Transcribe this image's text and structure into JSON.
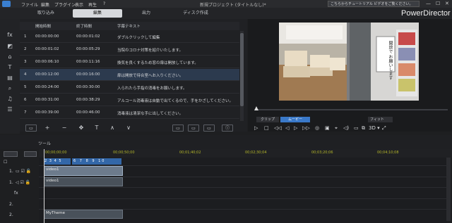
{
  "titlebar": {
    "menus": [
      "ファイル",
      "編集",
      "プラグイン",
      "表示",
      "再生",
      "?"
    ],
    "title": "新規プロジェクト (タイトルなし)*",
    "promo": "こちらからチュートリアル ビデオをご覧ください。",
    "win_buttons": [
      "—",
      "☐",
      "✕"
    ]
  },
  "modes": [
    "取り込み",
    "編集",
    "出力",
    "ディスク作成"
  ],
  "brand": "PowerDirector",
  "left_icons": [
    "fx",
    "◩",
    "⌂",
    "T",
    "▤",
    "⌕",
    "♫",
    "☰"
  ],
  "table": {
    "headers": [
      "開始時間",
      "終了時間",
      "字幕テキスト"
    ],
    "rows": [
      {
        "num": "1",
        "start": "00:00:00:00",
        "end": "00:00:01:02",
        "text": "ダブルクリックして編集"
      },
      {
        "num": "2",
        "start": "00:00:01:02",
        "end": "00:00:05:29",
        "text": "当院のコロナ対策を紹介いたします。"
      },
      {
        "num": "3",
        "start": "00:00:06:10",
        "end": "00:00:11:16",
        "text": "換気を良くするため窓の扉は開放しています。"
      },
      {
        "num": "4",
        "start": "00:00:12:00",
        "end": "00:00:16:00",
        "text": "扉は開放で待合室へお入りください。"
      },
      {
        "num": "5",
        "start": "00:00:24:00",
        "end": "00:00:30:00",
        "text": "入られたら手指の消毒をお願いします。"
      },
      {
        "num": "6",
        "start": "00:00:31:00",
        "end": "00:00:38:29",
        "text": "アルコール消毒液は自動で出てくるので、手をかざしてください。"
      },
      {
        "num": "7",
        "start": "00:00:39:00",
        "end": "00:00:46:00",
        "text": "消毒液は清潔な手に出してください。"
      }
    ],
    "toolbar": [
      "▭",
      "+",
      "−",
      "✥",
      "T",
      "∧",
      "∨",
      "▭",
      "▭",
      "▭",
      "ⓘ"
    ]
  },
  "preview": {
    "tabs": [
      "クリップ",
      "ムービー"
    ],
    "active_tab": "ムービー",
    "fit": "フィット",
    "controls": [
      "▷",
      "□",
      "◁◁",
      "◁",
      "▷",
      "▷▷",
      "◎",
      "▣",
      "⌖",
      "◁)",
      "▭",
      "⧉",
      "3D ▾",
      "⤢"
    ],
    "sign_text": "開放で お願いします"
  },
  "timeline": {
    "tool_label": "ツール",
    "ruler_ticks": [
      "00;00;00;00",
      "00;00;50;00",
      "00;01;40;02",
      "00;02;30;04",
      "00;03;20;06",
      "00;04;10;08"
    ],
    "tracks": [
      {
        "label": "1.",
        "kind": "video"
      },
      {
        "label": "1.",
        "kind": "audio"
      },
      {
        "label": "fx",
        "kind": "effect"
      },
      {
        "label": "2.",
        "kind": "video"
      },
      {
        "label": "2.",
        "kind": "audio"
      }
    ],
    "subtitle_markers": [
      "2",
      "3",
      "4",
      "5",
      "6",
      "7",
      "8",
      "9",
      "10"
    ],
    "clips": {
      "video": "video1",
      "audio": "video1",
      "music": "MyTheme"
    }
  }
}
